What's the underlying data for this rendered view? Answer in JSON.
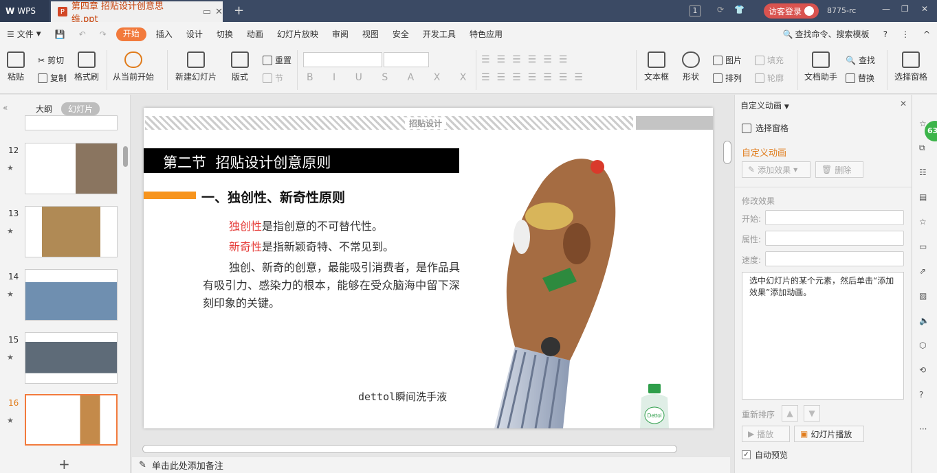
{
  "app": {
    "name": "WPS",
    "doc_tab": "第四章 招贴设计创意思维.ppt",
    "tab_badge": "1",
    "login": "访客登录",
    "user_id": "8775-rc"
  },
  "menu": {
    "file": "文件",
    "tabs": [
      "开始",
      "插入",
      "设计",
      "切换",
      "动画",
      "幻灯片放映",
      "审阅",
      "视图",
      "安全",
      "开发工具",
      "特色应用"
    ],
    "search": "查找命令、搜索模板"
  },
  "ribbon": {
    "paste": "粘贴",
    "cut": "剪切",
    "copy": "复制",
    "format_painter": "格式刷",
    "from_current": "从当前开始",
    "new_slide": "新建幻灯片",
    "layout": "版式",
    "reset": "重置",
    "section": "节",
    "textbox": "文本框",
    "shape": "形状",
    "picture": "图片",
    "fill": "填充",
    "arrange": "排列",
    "outline": "轮廓",
    "doc_assistant": "文档助手",
    "find": "查找",
    "replace": "替换",
    "select_pane": "选择窗格"
  },
  "left_panel": {
    "tab_outline": "大纲",
    "tab_slides": "幻灯片",
    "slides": [
      {
        "num": "12"
      },
      {
        "num": "13"
      },
      {
        "num": "14"
      },
      {
        "num": "15"
      },
      {
        "num": "16"
      }
    ]
  },
  "slide": {
    "banner": "招贴设计",
    "title": "第二节  招贴设计创意原则",
    "subtitle": "一、独创性、新奇性原则",
    "p1_red": "独创性",
    "p1_rest": "是指创意的不可替代性。",
    "p2_red": "新奇性",
    "p2_rest": "是指新颖奇特、不常见到。",
    "p3": "独创、新奇的创意，最能吸引消费者，是作品具有吸引力、感染力的根本，能够在受众脑海中留下深刻印象的关键。",
    "caption": "dettol瞬间洗手液",
    "bottle_label": "Dettol"
  },
  "anim_panel": {
    "header": "自定义动画",
    "select_pane": "选择窗格",
    "section": "自定义动画",
    "add_effect": "添加效果",
    "delete": "删除",
    "modify": "修改效果",
    "start_label": "开始:",
    "property_label": "属性:",
    "speed_label": "速度:",
    "hint": "选中幻灯片的某个元素，然后单击“添加效果”添加动画。",
    "reorder": "重新排序",
    "play": "播放",
    "slideshow": "幻灯片播放",
    "auto_preview": "自动预览"
  },
  "notes": {
    "placeholder": "单击此处添加备注"
  },
  "badge": "63",
  "colors": {
    "accent": "#f27a3c",
    "red_text": "#e53935",
    "title_bg": "#000000",
    "orange_bar": "#f7941d"
  }
}
